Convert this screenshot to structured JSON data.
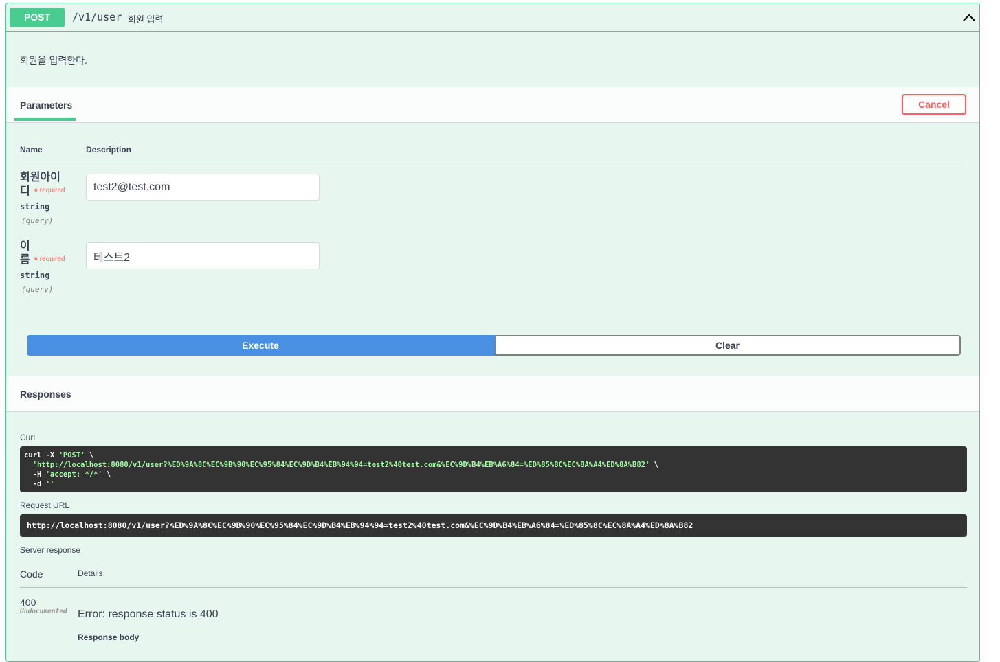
{
  "operation": {
    "method": "POST",
    "path": "/v1/user",
    "summary": "회원 입력",
    "description": "회원을 입력한다."
  },
  "parameters_section": {
    "tab_label": "Parameters",
    "cancel_label": "Cancel",
    "col_name": "Name",
    "col_description": "Description",
    "required_star": "*",
    "required_text": "required",
    "params": [
      {
        "name_line1": "회원아이",
        "name_line2": "디",
        "type": "string",
        "in": "(query)",
        "value": "test2@test.com"
      },
      {
        "name_line1": "이",
        "name_line2": "름",
        "type": "string",
        "in": "(query)",
        "value": "테스트2"
      }
    ]
  },
  "actions": {
    "execute_label": "Execute",
    "clear_label": "Clear"
  },
  "responses_section": {
    "title": "Responses",
    "curl_label": "Curl",
    "curl_line1_cmd": "curl -X ",
    "curl_line1_str": "'POST'",
    "curl_line1_end": " \\",
    "curl_line2_str": "  'http://localhost:8080/v1/user?%ED%9A%8C%EC%9B%90%EC%95%84%EC%9D%B4%EB%94%94=test2%40test.com&%EC%9D%B4%EB%A6%84=%ED%85%8C%EC%8A%A4%ED%8A%B82'",
    "curl_line2_end": " \\",
    "curl_line3_cmd": "  -H ",
    "curl_line3_str": "'accept: */*'",
    "curl_line3_end": " \\",
    "curl_line4_cmd": "  -d ",
    "curl_line4_str": "''",
    "request_url_label": "Request URL",
    "request_url": "http://localhost:8080/v1/user?%ED%9A%8C%EC%9B%90%EC%95%84%EC%9D%B4%EB%94%94=test2%40test.com&%EC%9D%B4%EB%A6%84=%ED%85%8C%EC%8A%A4%ED%8A%B82",
    "server_response_label": "Server response",
    "col_code": "Code",
    "col_details": "Details",
    "code": "400",
    "undocumented": "Undocumented",
    "error_text": "Error: response status is 400",
    "response_body_label": "Response body"
  },
  "colors": {
    "post_green": "#49cc90",
    "block_bg": "#e8f6f0",
    "execute_blue": "#4990e2",
    "cancel_red": "#ff6060",
    "code_bg": "#333333"
  }
}
